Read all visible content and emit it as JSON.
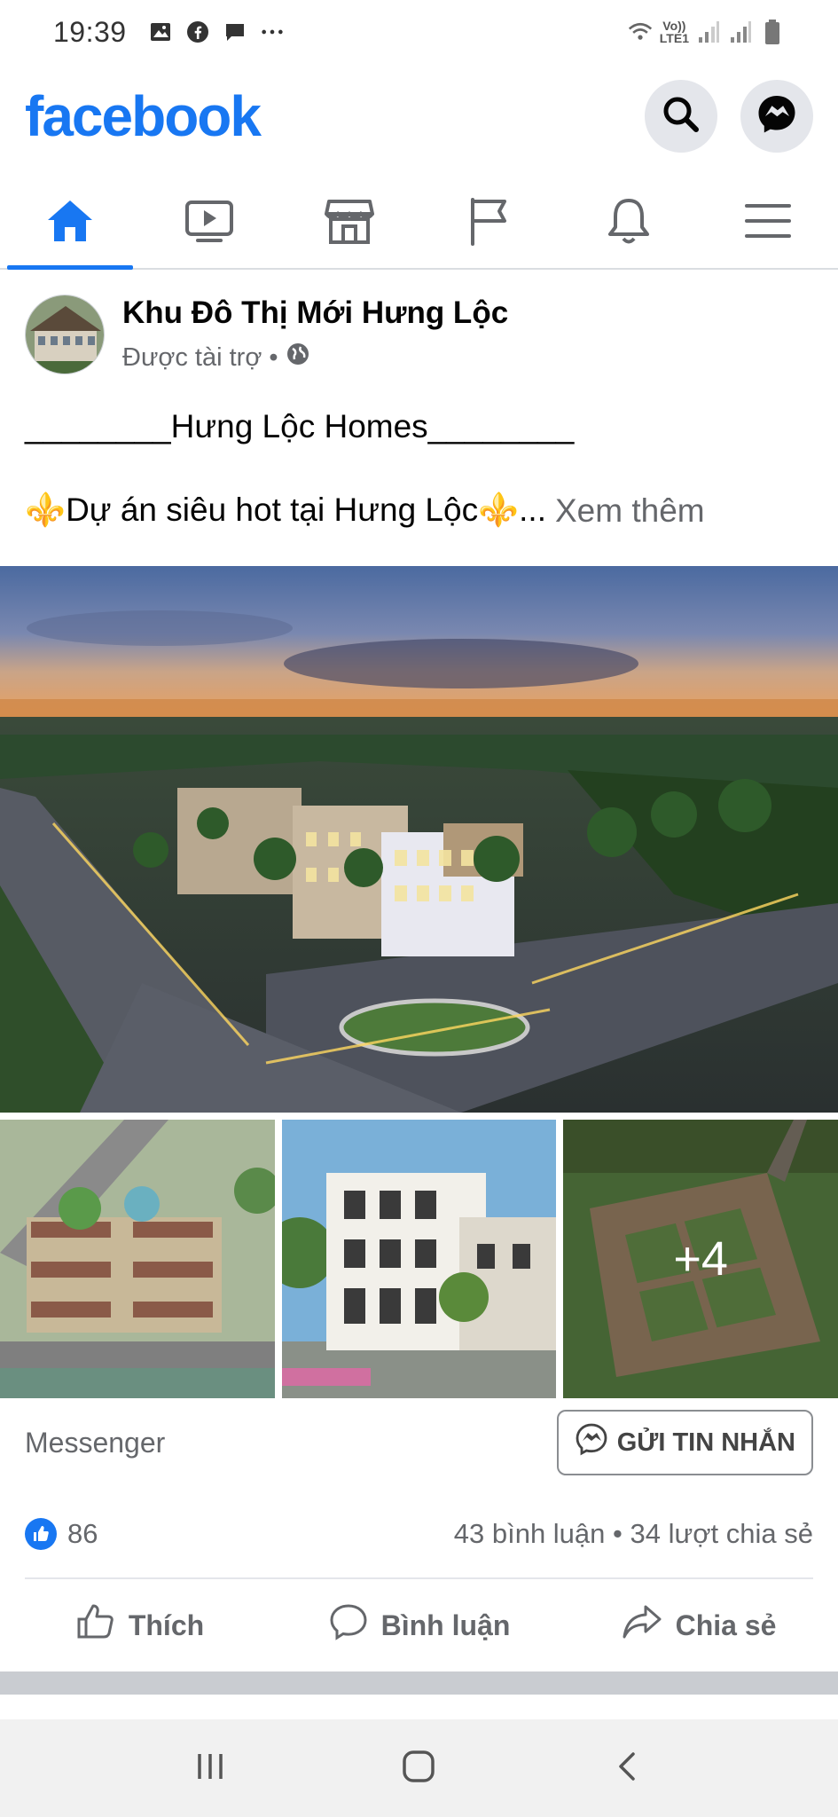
{
  "status_bar": {
    "time": "19:39",
    "left_icons": [
      "gallery-icon",
      "facebook-icon",
      "message-icon",
      "more-dots-icon"
    ],
    "right_icons": [
      "wifi-calling-icon",
      "volte-lte-icon",
      "signal-icon",
      "signal-icon",
      "battery-icon"
    ],
    "lte_label_top": "Vo))",
    "lte_label_bottom": "LTE1"
  },
  "header": {
    "brand": "facebook",
    "brand_color": "#1877f2",
    "actions": [
      "search-icon",
      "messenger-icon"
    ]
  },
  "nav": {
    "tabs": [
      {
        "name": "home",
        "icon": "home-icon",
        "active": true
      },
      {
        "name": "watch",
        "icon": "video-icon",
        "active": false
      },
      {
        "name": "marketplace",
        "icon": "shop-icon",
        "active": false
      },
      {
        "name": "pages",
        "icon": "flag-icon",
        "active": false
      },
      {
        "name": "notifications",
        "icon": "bell-icon",
        "active": false
      },
      {
        "name": "menu",
        "icon": "hamburger-icon",
        "active": false
      }
    ]
  },
  "post": {
    "page_name": "Khu Đô Thị Mới Hưng Lộc",
    "sponsored": "Được tài trợ •",
    "text_line1": "________Hưng Lộc Homes________",
    "text_line2": "⚜️Dự án siêu hot tại Hưng Lộc⚜️...",
    "see_more": "Xem thêm",
    "more_photos": "+4",
    "cta_source": "Messenger",
    "cta_button": "GỬI TIN NHẮN",
    "reactions_count": "86",
    "comments_shares": "43 bình luận • 34 lượt chia sẻ",
    "actions": {
      "like": "Thích",
      "comment": "Bình luận",
      "share": "Chia sẻ"
    }
  },
  "system_nav": {
    "buttons": [
      "recent-apps-icon",
      "home-button-icon",
      "back-icon"
    ]
  }
}
